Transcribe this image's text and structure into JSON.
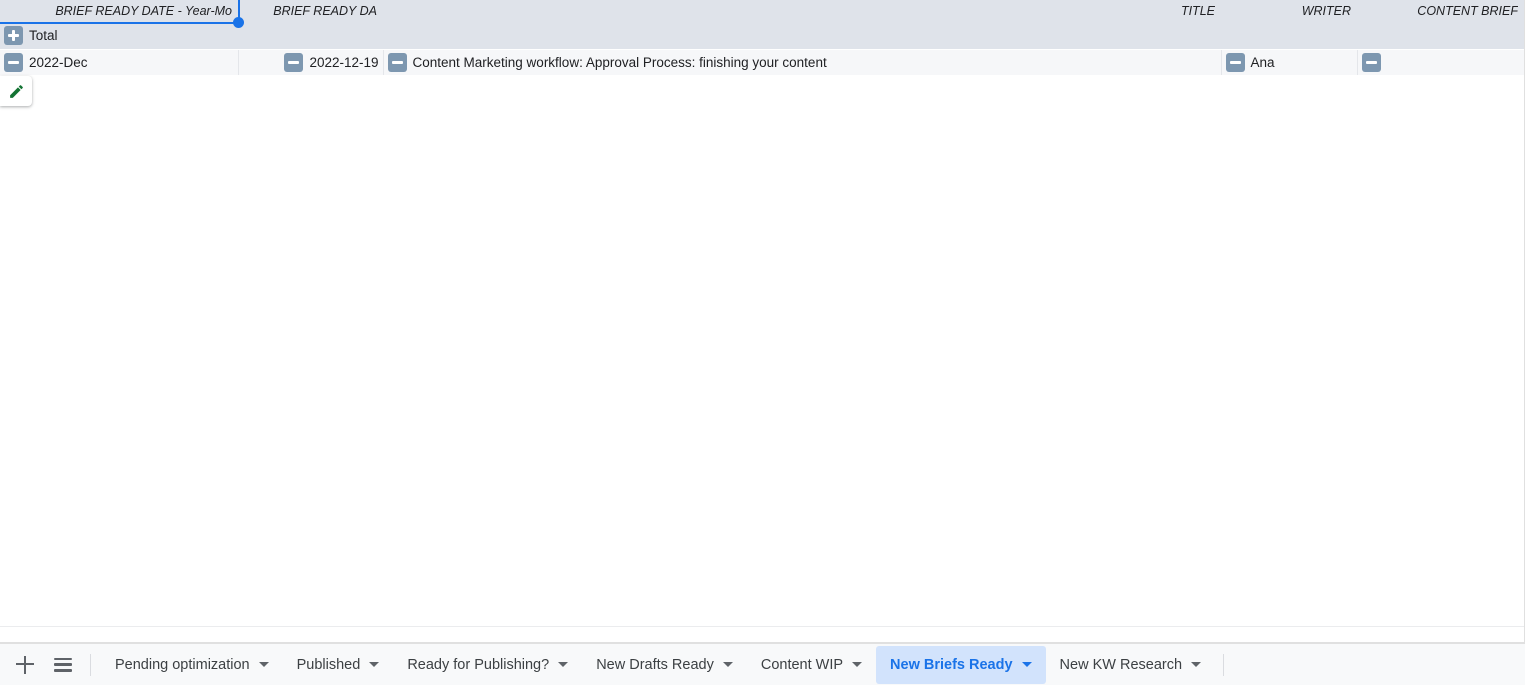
{
  "grid": {
    "columns": [
      {
        "key": "month",
        "label": "BRIEF READY DATE - Year-Mo"
      },
      {
        "key": "date",
        "label": "BRIEF READY DA"
      },
      {
        "key": "title",
        "label": "TITLE"
      },
      {
        "key": "writer",
        "label": "WRITER"
      },
      {
        "key": "brief",
        "label": "CONTENT BRIEF"
      }
    ],
    "total_row": {
      "toggle": "plus-icon",
      "label": "Total"
    },
    "rows": [
      {
        "month_toggle": "minus-icon",
        "month": "2022-Dec",
        "date_toggle": "minus-icon",
        "date": "2022-12-19",
        "title_toggle": "minus-icon",
        "title": "Content Marketing workflow: Approval Process: finishing your content",
        "writer_toggle": "minus-icon",
        "writer": "Ana",
        "brief_toggle": "minus-icon",
        "brief": ""
      }
    ],
    "selection": {
      "accent_color": "#1a73e8",
      "handle": "resize-handle"
    },
    "edit_chip": {
      "icon": "pencil-edit-icon",
      "color": "#137333"
    }
  },
  "tabbar": {
    "add_sheet_icon": "plus-icon",
    "all_sheets_icon": "hamburger-menu-icon",
    "tabs": [
      {
        "label": "Pending optimization",
        "active": false
      },
      {
        "label": "Published",
        "active": false
      },
      {
        "label": "Ready for Publishing?",
        "active": false
      },
      {
        "label": "New Drafts Ready",
        "active": false
      },
      {
        "label": "Content WIP",
        "active": false
      },
      {
        "label": "New Briefs Ready",
        "active": true
      },
      {
        "label": "New KW Research",
        "active": false
      }
    ],
    "active_tab_bg": "#d2e3fc",
    "active_tab_color": "#1a73e8"
  }
}
